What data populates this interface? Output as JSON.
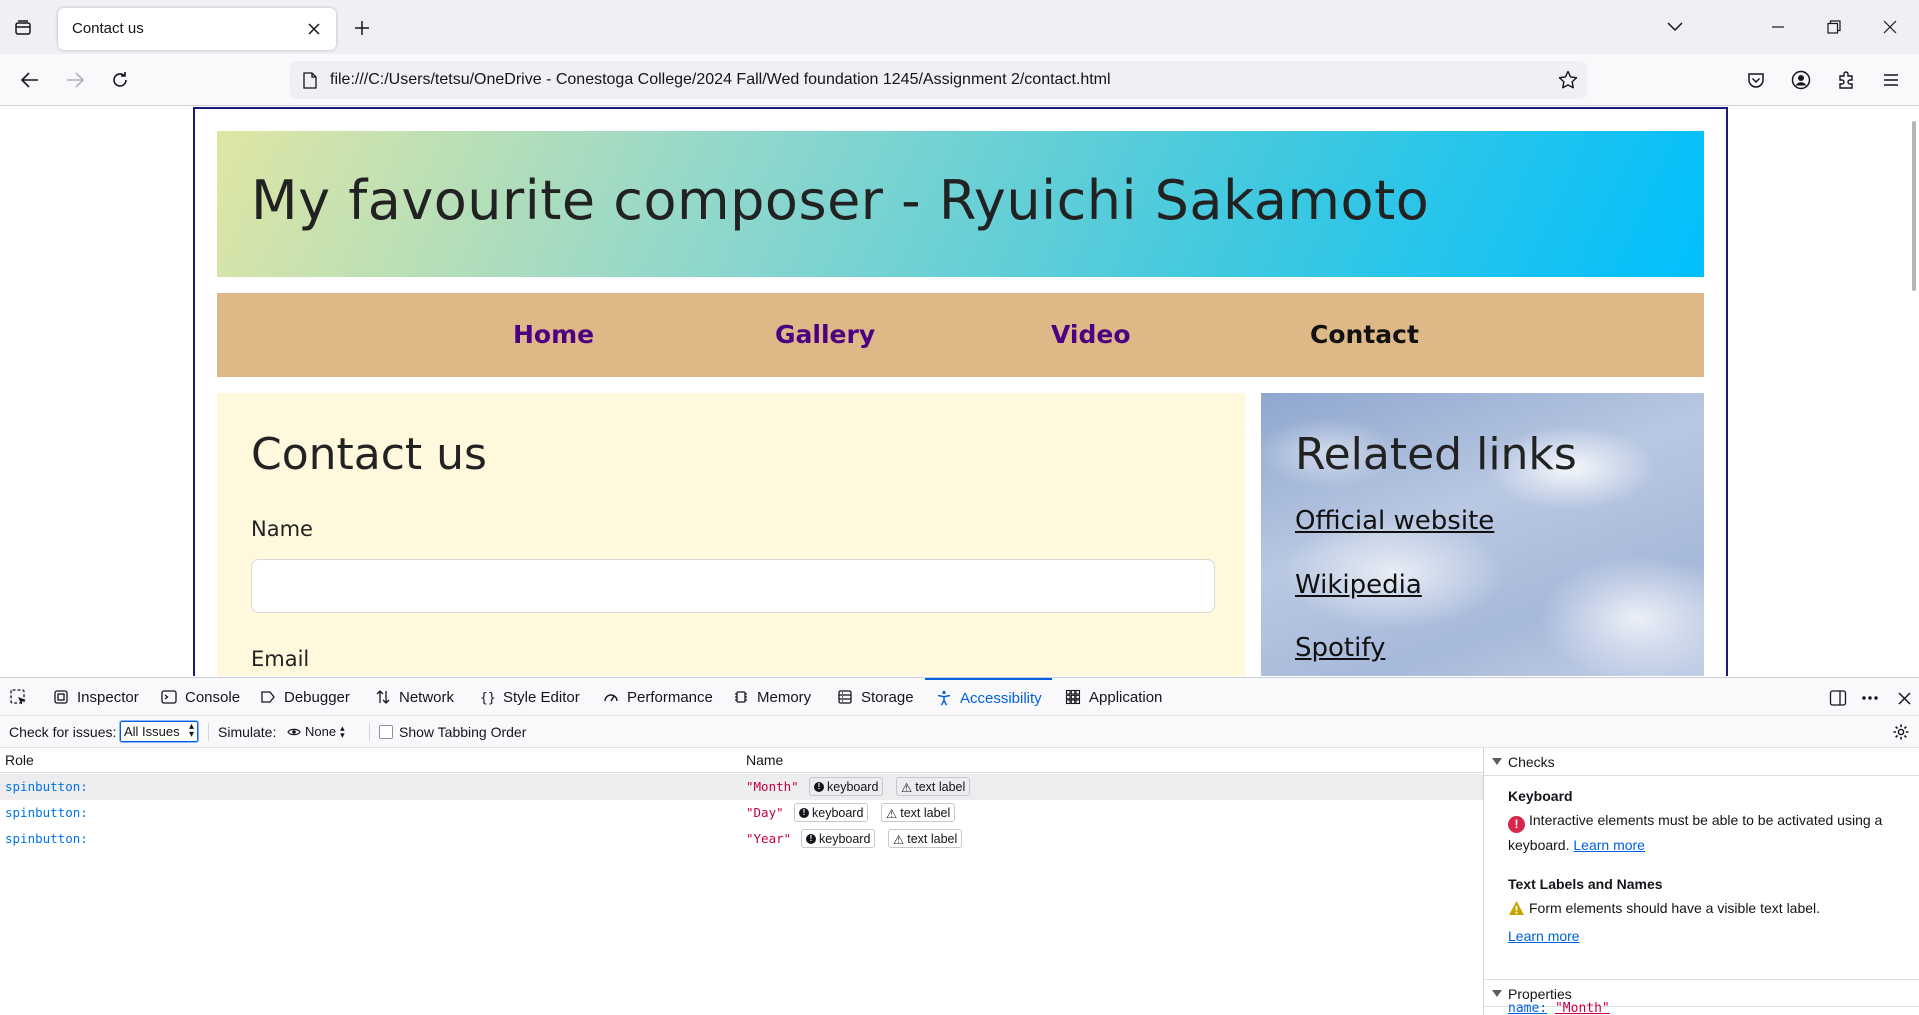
{
  "browser": {
    "tab_title": "Contact us",
    "url": "file:///C:/Users/tetsu/OneDrive - Conestoga College/2024 Fall/Wed foundation 1245/Assignment 2/contact.html"
  },
  "page": {
    "header_title": "My favourite composer - Ryuichi Sakamoto",
    "nav": [
      "Home",
      "Gallery",
      "Video",
      "Contact"
    ],
    "nav_active": "Contact",
    "contact_heading": "Contact us",
    "name_label": "Name",
    "email_label": "Email",
    "links_heading": "Related links",
    "links": [
      "Official website",
      "Wikipedia",
      "Spotify"
    ],
    "colors": {
      "frame_border": "#1b1b7a",
      "nav_bg": "#deb887",
      "nav_link": "#4b0082",
      "contact_bg": "#fff8dc"
    }
  },
  "devtools": {
    "tabs": [
      "Inspector",
      "Console",
      "Debugger",
      "Network",
      "Style Editor",
      "Performance",
      "Memory",
      "Storage",
      "Accessibility",
      "Application"
    ],
    "active_tab": "Accessibility",
    "check_for_issues_label": "Check for issues:",
    "check_for_issues_value": "All Issues",
    "simulate_label": "Simulate:",
    "simulate_value": "None",
    "show_tabbing_order": "Show Tabbing Order",
    "columns": {
      "role": "Role",
      "name": "Name"
    },
    "rows": [
      {
        "role": "spinbutton:",
        "name": "\"Month\"",
        "badges": [
          "keyboard",
          "text label"
        ]
      },
      {
        "role": "spinbutton:",
        "name": "\"Day\"",
        "badges": [
          "keyboard",
          "text label"
        ]
      },
      {
        "role": "spinbutton:",
        "name": "\"Year\"",
        "badges": [
          "keyboard",
          "text label"
        ]
      }
    ],
    "checks_heading": "Checks",
    "checks": [
      {
        "title": "Keyboard",
        "text": "Interactive elements must be able to be activated using a keyboard.",
        "link": "Learn more",
        "severity": "error"
      },
      {
        "title": "Text Labels and Names",
        "text": "Form elements should have a visible text label.",
        "link": "Learn more",
        "severity": "warning"
      }
    ],
    "properties_heading": "Properties",
    "property_name_key": "name:",
    "property_name_value": "\"Month\""
  }
}
